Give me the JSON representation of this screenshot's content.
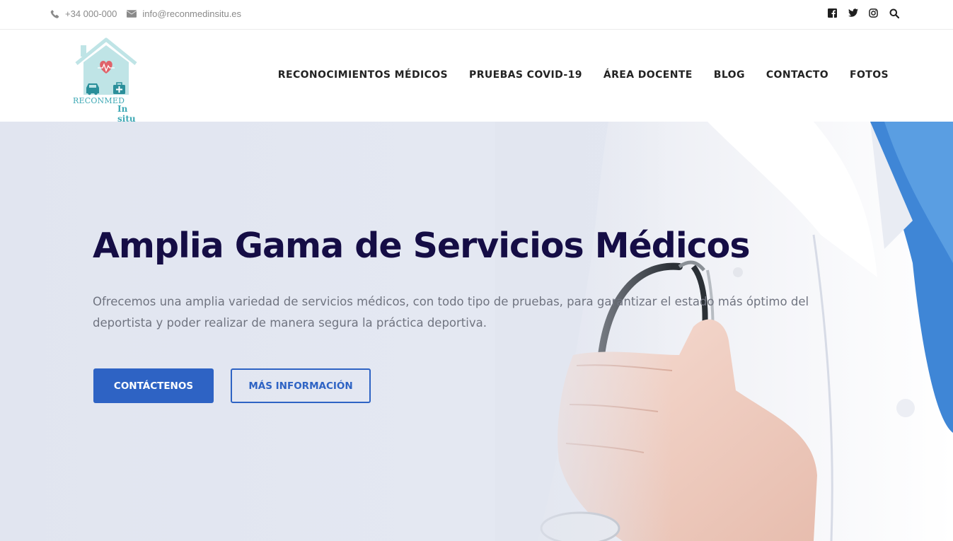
{
  "topbar": {
    "phone": "+34 000-000",
    "email": "info@reconmedinsitu.es",
    "social": [
      "facebook-icon",
      "twitter-icon",
      "instagram-icon",
      "search-icon"
    ]
  },
  "logo": {
    "line1": "RECONMED",
    "line2": "In situ"
  },
  "nav": {
    "items": [
      {
        "label": "RECONOCIMIENTOS MÉDICOS"
      },
      {
        "label": "PRUEBAS COVID-19"
      },
      {
        "label": "ÁREA DOCENTE"
      },
      {
        "label": "BLOG"
      },
      {
        "label": "CONTACTO"
      },
      {
        "label": "FOTOS"
      }
    ]
  },
  "hero": {
    "title": "Amplia Gama de Servicios Médicos",
    "description": "Ofrecemos una amplia variedad de servicios médicos, con todo tipo de pruebas, para garantizar el estado más óptimo del deportista y poder realizar de manera segura la práctica deportiva.",
    "primary_button": "CONTÁCTENOS",
    "secondary_button": "MÁS INFORMACIÓN"
  },
  "colors": {
    "accent": "#2e63c4",
    "title": "#150d45",
    "logo": "#3fa9b5"
  }
}
